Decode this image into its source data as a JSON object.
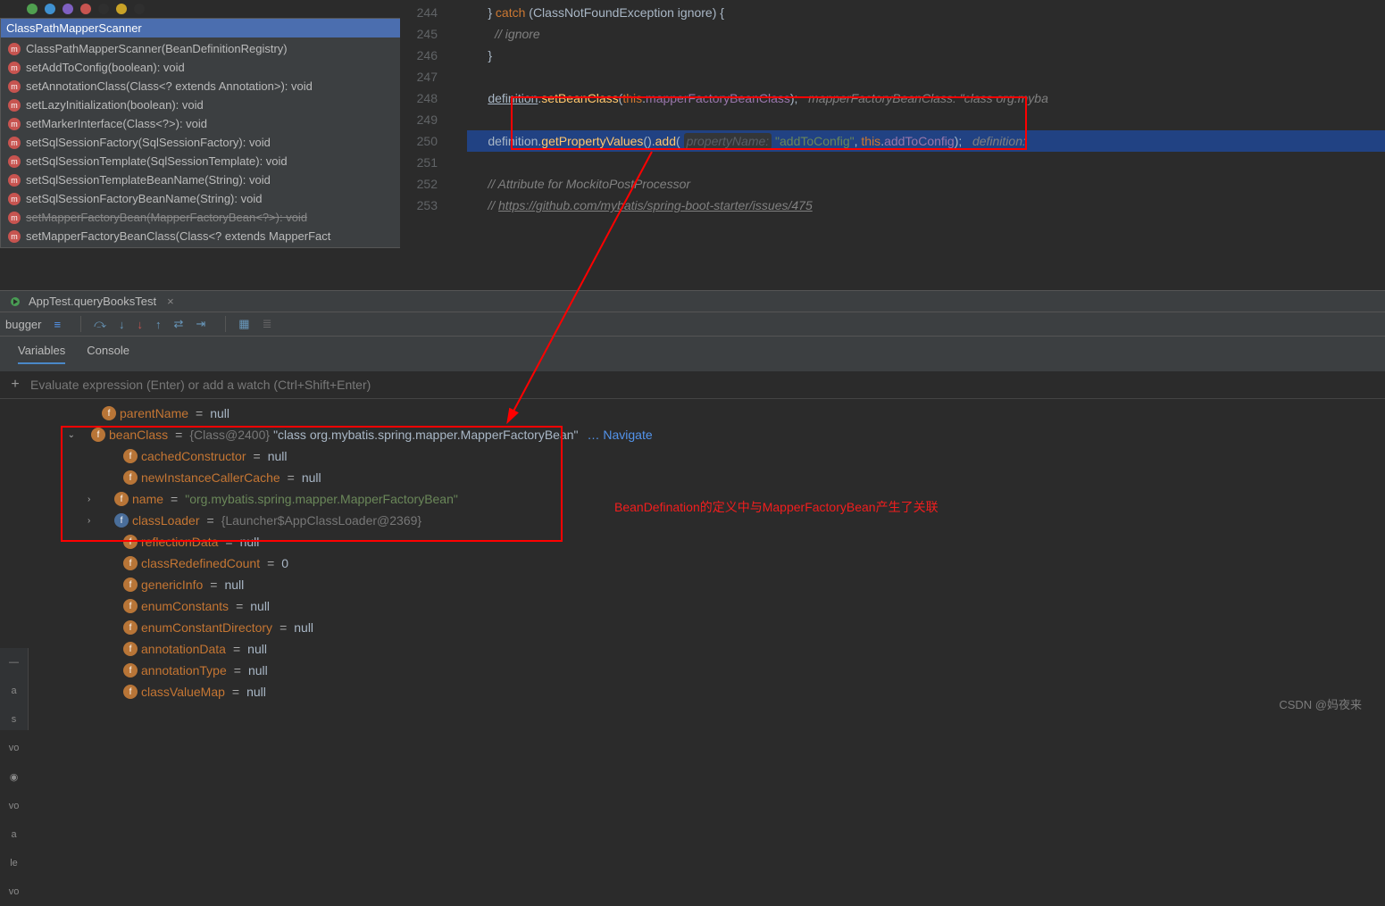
{
  "structure": {
    "title": "ClassPathMapperScanner",
    "items": [
      {
        "icon": "m",
        "label": "ClassPathMapperScanner(BeanDefinitionRegistry)",
        "strike": false
      },
      {
        "icon": "m",
        "label": "setAddToConfig(boolean): void",
        "strike": false
      },
      {
        "icon": "m",
        "label": "setAnnotationClass(Class<? extends Annotation>): void",
        "strike": false
      },
      {
        "icon": "m",
        "label": "setLazyInitialization(boolean): void",
        "strike": false
      },
      {
        "icon": "m",
        "label": "setMarkerInterface(Class<?>): void",
        "strike": false
      },
      {
        "icon": "m",
        "label": "setSqlSessionFactory(SqlSessionFactory): void",
        "strike": false
      },
      {
        "icon": "m",
        "label": "setSqlSessionTemplate(SqlSessionTemplate): void",
        "strike": false
      },
      {
        "icon": "m",
        "label": "setSqlSessionTemplateBeanName(String): void",
        "strike": false
      },
      {
        "icon": "m",
        "label": "setSqlSessionFactoryBeanName(String): void",
        "strike": false
      },
      {
        "icon": "m",
        "label": "setMapperFactoryBean(MapperFactoryBean<?>): void",
        "strike": true
      },
      {
        "icon": "m",
        "label": "setMapperFactoryBeanClass(Class<? extends MapperFact",
        "strike": false
      }
    ]
  },
  "editor": {
    "startLine": 244
  },
  "run": {
    "tabLabel": "AppTest.queryBooksTest",
    "debuggerLabel": "bugger"
  },
  "dbgTabs": {
    "variables": "Variables",
    "console": "Console"
  },
  "evalPlaceholder": "Evaluate expression (Enter) or add a watch (Ctrl+Shift+Enter)",
  "vars": {
    "parentName": "parentName",
    "beanClass": "beanClass",
    "beanClassType": "{Class@2400}",
    "beanClassVal": "\"class org.mybatis.spring.mapper.MapperFactoryBean\"",
    "navigate": "… Navigate",
    "cachedConstructor": "cachedConstructor",
    "newInstanceCallerCache": "newInstanceCallerCache",
    "name": "name",
    "nameVal": "\"org.mybatis.spring.mapper.MapperFactoryBean\"",
    "classLoader": "classLoader",
    "classLoaderVal": "{Launcher$AppClassLoader@2369}",
    "reflectionData": "reflectionData",
    "classRedefinedCount": "classRedefinedCount",
    "zero": "0",
    "genericInfo": "genericInfo",
    "enumConstants": "enumConstants",
    "enumConstantDirectory": "enumConstantDirectory",
    "annotationData": "annotationData",
    "annotationType": "annotationType",
    "classValueMap": "classValueMap",
    "nullv": "null"
  },
  "annotation": "BeanDefination的定义中与MapperFactoryBean产生了关联",
  "watermark": "CSDN @妈夜来"
}
